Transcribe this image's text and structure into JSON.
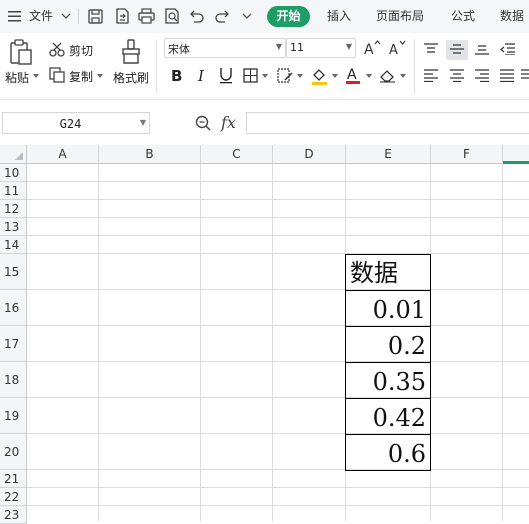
{
  "menu": {
    "file": "文件",
    "tabs": [
      "开始",
      "插入",
      "页面布局",
      "公式",
      "数据"
    ]
  },
  "ribbon": {
    "paste": "粘贴",
    "cut": "剪切",
    "copy": "复制",
    "format_painter": "格式刷",
    "font_name": "宋体",
    "font_size": "11"
  },
  "formula_bar": {
    "name_box": "G24",
    "fx": "fx",
    "content": ""
  },
  "grid": {
    "columns": [
      "A",
      "B",
      "C",
      "D",
      "E",
      "F"
    ],
    "rows": [
      "10",
      "11",
      "12",
      "13",
      "14",
      "15",
      "16",
      "17",
      "18",
      "19",
      "20",
      "21",
      "22",
      "23"
    ]
  },
  "cells": {
    "E15": "数据",
    "E16": "0.01",
    "E17": "0.2",
    "E18": "0.35",
    "E19": "0.42",
    "E20": "0.6"
  },
  "colors": {
    "accent": "#1c9e66",
    "menubar_bg": "#f5f6f7",
    "header_bg": "#f4f5f6",
    "selected_col_tab": "#1c9e66"
  },
  "icons": [
    "menu-icon",
    "save-icon",
    "export-icon",
    "print-icon",
    "print-preview-icon",
    "undo-icon",
    "redo-icon",
    "more-icon",
    "paste-icon",
    "cut-icon",
    "copy-icon",
    "format-painter-icon",
    "font-grow-icon",
    "font-shrink-icon",
    "bold-icon",
    "italic-icon",
    "underline-icon",
    "border-icon",
    "fill-color-icon",
    "font-color-icon",
    "clear-icon",
    "zoom-icon"
  ]
}
